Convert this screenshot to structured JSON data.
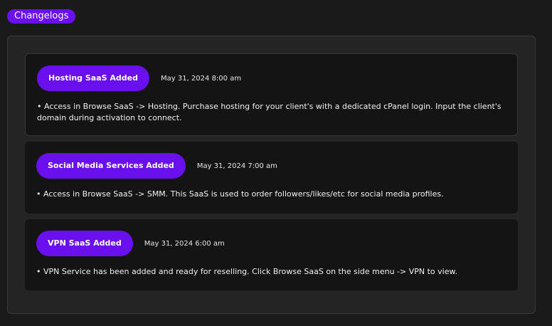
{
  "section": {
    "title": "Changelogs"
  },
  "changelogs": [
    {
      "title": "Hosting SaaS Added",
      "date": "May 31, 2024 8:00 am",
      "body": "• Access in Browse SaaS -> Hosting. Purchase hosting for your client's with a dedicated cPanel login. Input the client's domain during activation to connect."
    },
    {
      "title": "Social Media Services Added",
      "date": "May 31, 2024 7:00 am",
      "body": "• Access in Browse SaaS -> SMM. This SaaS is used to order followers/likes/etc for social media profiles."
    },
    {
      "title": "VPN SaaS Added",
      "date": "May 31, 2024 6:00 am",
      "body": "• VPN Service has been added and ready for reselling. Click Browse SaaS on the side menu -> VPN to view."
    }
  ],
  "colors": {
    "accent": "#6a10ef",
    "page_background": "#1a1a1a",
    "panel_background": "#242424",
    "card_background": "#141414"
  }
}
